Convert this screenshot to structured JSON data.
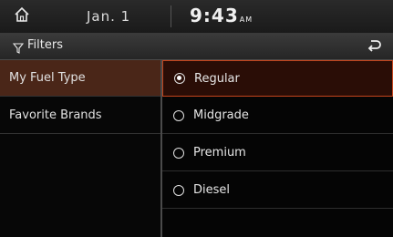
{
  "status": {
    "date": "Jan.  1",
    "time": "9:43",
    "ampm": "AM"
  },
  "filters": {
    "label": "Filters"
  },
  "categories": [
    {
      "label": "My Fuel Type",
      "selected": true
    },
    {
      "label": "Favorite Brands",
      "selected": false
    }
  ],
  "options": [
    {
      "label": "Regular",
      "checked": true
    },
    {
      "label": "Midgrade",
      "checked": false
    },
    {
      "label": "Premium",
      "checked": false
    },
    {
      "label": "Diesel",
      "checked": false
    }
  ],
  "colors": {
    "accent": "#c4441c",
    "selected_bg": "#4a2618"
  }
}
